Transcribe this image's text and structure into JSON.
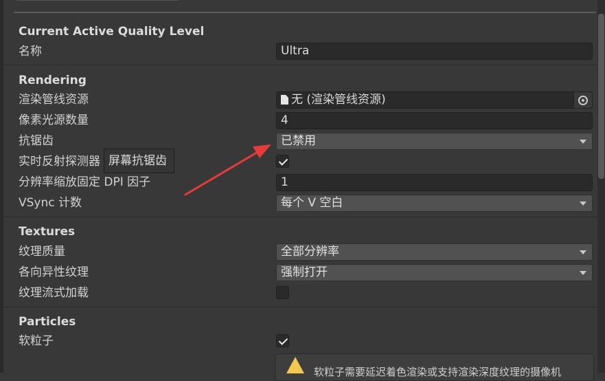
{
  "sections": {
    "current": {
      "header": "Current Active Quality Level",
      "name_label": "名称",
      "name_value": "Ultra"
    },
    "rendering": {
      "header": "Rendering",
      "pipeline_label": "渲染管线资源",
      "pipeline_value": "无 (渲染管线资源)",
      "pixel_lights_label": "像素光源数量",
      "pixel_lights_value": "4",
      "aa_label": "抗锯齿",
      "aa_value": "已禁用",
      "realtime_probes_label": "实时反射探测器",
      "realtime_probes_checked": true,
      "dpi_label": "分辨率缩放固定 DPI 因子",
      "dpi_value": "1",
      "vsync_label": "VSync 计数",
      "vsync_value": "每个 V 空白"
    },
    "textures": {
      "header": "Textures",
      "quality_label": "纹理质量",
      "quality_value": "全部分辨率",
      "aniso_label": "各向异性纹理",
      "aniso_value": "强制打开",
      "streaming_label": "纹理流式加载",
      "streaming_checked": false
    },
    "particles": {
      "header": "Particles",
      "soft_label": "软粒子",
      "soft_checked": true,
      "warning_text": "软粒子需要延迟着色渲染或支持渲染深度纹理的摄像机"
    }
  },
  "tooltip": "屏幕抗锯齿",
  "icons": {
    "pipeline_file": "file-icon",
    "pipeline_picker": "object-picker-icon",
    "warning": "warning-icon",
    "annotation": "red-arrow-icon"
  },
  "colors": {
    "background": "#383838",
    "field": "#2a2a2a",
    "dropdown": "#515151",
    "annotation_arrow": "#e83a3a",
    "warning": "#f2c94c"
  }
}
